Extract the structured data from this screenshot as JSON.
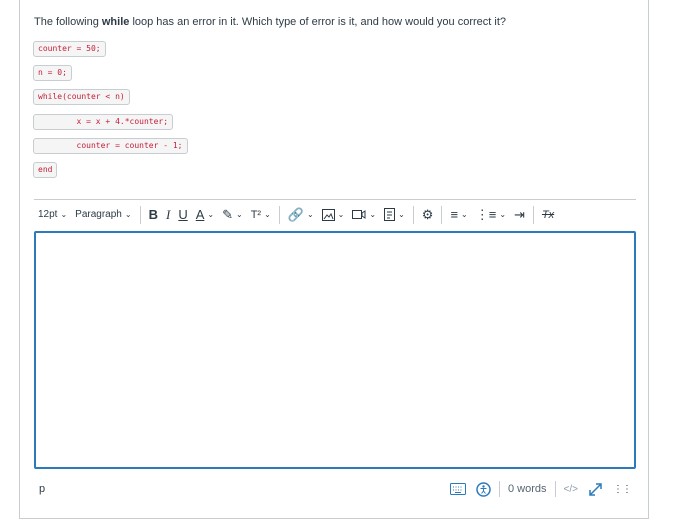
{
  "question": {
    "part1": "The following ",
    "bold": "while",
    "part2": " loop has an error in it. Which type of error is it, and how would you correct it?"
  },
  "code_lines": [
    "counter = 50;",
    "n = 0;",
    "while(counter < n)",
    "        x = x + 4.*counter;",
    "        counter = counter - 1;",
    "end"
  ],
  "toolbar": {
    "font_size": "12pt",
    "block_format": "Paragraph",
    "bold": "B",
    "italic": "I",
    "underline": "U",
    "text_color": "A",
    "superscript": "T²",
    "clear_format": "Tx"
  },
  "editor": {
    "content": ""
  },
  "status": {
    "path": "p",
    "word_count": "0 words",
    "html_toggle": "</>"
  },
  "colors": {
    "accent": "#2b7abc",
    "code_text": "#c41e3a",
    "border": "#c7cdd1"
  }
}
